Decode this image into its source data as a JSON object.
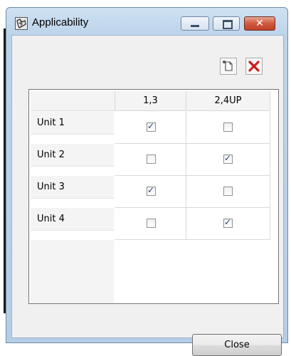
{
  "window": {
    "title": "Applicability",
    "title_icon": "applicability-app-icon",
    "controls": {
      "minimize_icon": "minimize-icon",
      "maximize_icon": "maximize-icon",
      "close_icon": "close-icon",
      "close_glyph": "✕"
    }
  },
  "toolbar": {
    "new_icon": "new-document-icon",
    "delete_icon": "delete-x-icon"
  },
  "grid": {
    "columns": [
      "1,3",
      "2,4UP"
    ],
    "rows": [
      {
        "label": "Unit 1",
        "checks": [
          true,
          false
        ]
      },
      {
        "label": "Unit 2",
        "checks": [
          false,
          true
        ]
      },
      {
        "label": "Unit 3",
        "checks": [
          true,
          false
        ]
      },
      {
        "label": "Unit 4",
        "checks": [
          false,
          true
        ]
      }
    ]
  },
  "footer": {
    "close_label": "Close"
  },
  "colors": {
    "title_bar": "#bcd3ea",
    "close_button": "#c2402a",
    "check_mark": "#2a3f8a"
  }
}
